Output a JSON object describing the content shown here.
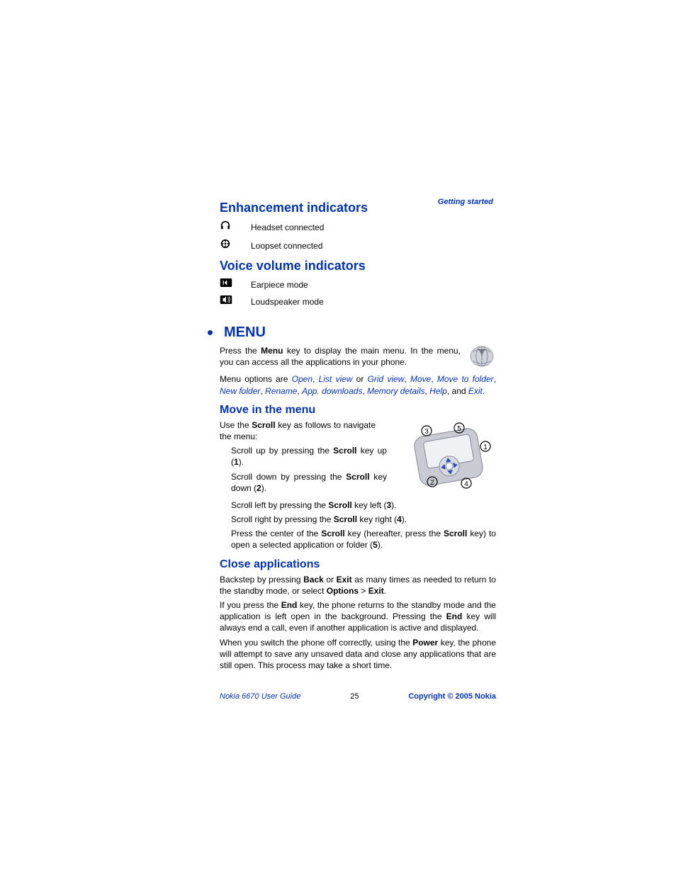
{
  "header": {
    "link": "Getting started"
  },
  "sections": {
    "enhancement": {
      "title": "Enhancement indicators",
      "items": [
        {
          "label": "Headset connected"
        },
        {
          "label": "Loopset connected"
        }
      ]
    },
    "voice": {
      "title": "Voice volume indicators",
      "items": [
        {
          "label": "Earpiece mode"
        },
        {
          "label": "Loudspeaker mode"
        }
      ]
    },
    "menu": {
      "title": "MENU",
      "intro_1a": "Press the ",
      "intro_1b": "Menu",
      "intro_1c": " key to display the main menu. In the menu, you can access all the applications in your phone.",
      "intro_2a": "Menu options are ",
      "links": [
        "Open",
        "List view",
        "Grid view",
        "Move",
        "Move to folder",
        "New folder",
        "Rename",
        "App. downloads",
        "Memory details",
        "Help",
        "Exit"
      ],
      "or_word": " or ",
      "and_word": ", and "
    },
    "move": {
      "title": "Move in the menu",
      "intro_a": "Use the ",
      "intro_b": "Scroll",
      "intro_c": " key as follows to navigate the menu:",
      "steps": [
        {
          "a": "Scroll up by pressing the ",
          "b": "Scroll",
          "c": " key up (",
          "d": "1",
          "e": ")."
        },
        {
          "a": "Scroll down by pressing the ",
          "b": "Scroll",
          "c": " key down (",
          "d": "2",
          "e": ")."
        },
        {
          "a": "Scroll left by pressing the ",
          "b": "Scroll",
          "c": " key left (",
          "d": "3",
          "e": ")."
        },
        {
          "a": "Scroll right by pressing the ",
          "b": "Scroll",
          "c": " key right (",
          "d": "4",
          "e": ")."
        }
      ],
      "center_a": "Press the center of the ",
      "center_b": "Scroll",
      "center_c": " key (hereafter, press the ",
      "center_d": "Scroll",
      "center_e": " key) to open a selected application or folder (",
      "center_f": "5",
      "center_g": ")."
    },
    "close": {
      "title": "Close applications",
      "p1_a": "Backstep by pressing ",
      "p1_b": "Back",
      "p1_c": " or ",
      "p1_d": "Exit",
      "p1_e": " as many times as needed to return to the standby mode, or select ",
      "p1_f": "Options",
      "p1_g": " > ",
      "p1_h": "Exit",
      "p1_i": ".",
      "p2_a": "If you press the ",
      "p2_b": "End",
      "p2_c": " key, the phone returns to the standby mode and the application is left open in the background. Pressing the ",
      "p2_d": "End",
      "p2_e": " key will always end a call, even if another application is active and displayed.",
      "p3_a": "When you switch the phone off correctly, using the ",
      "p3_b": "Power",
      "p3_c": " key, the phone will attempt to save any unsaved data and close any applications that are still open. This process may take a short time."
    }
  },
  "footer": {
    "left": "Nokia 6670 User Guide",
    "center": "25",
    "right": "Copyright © 2005 Nokia"
  }
}
